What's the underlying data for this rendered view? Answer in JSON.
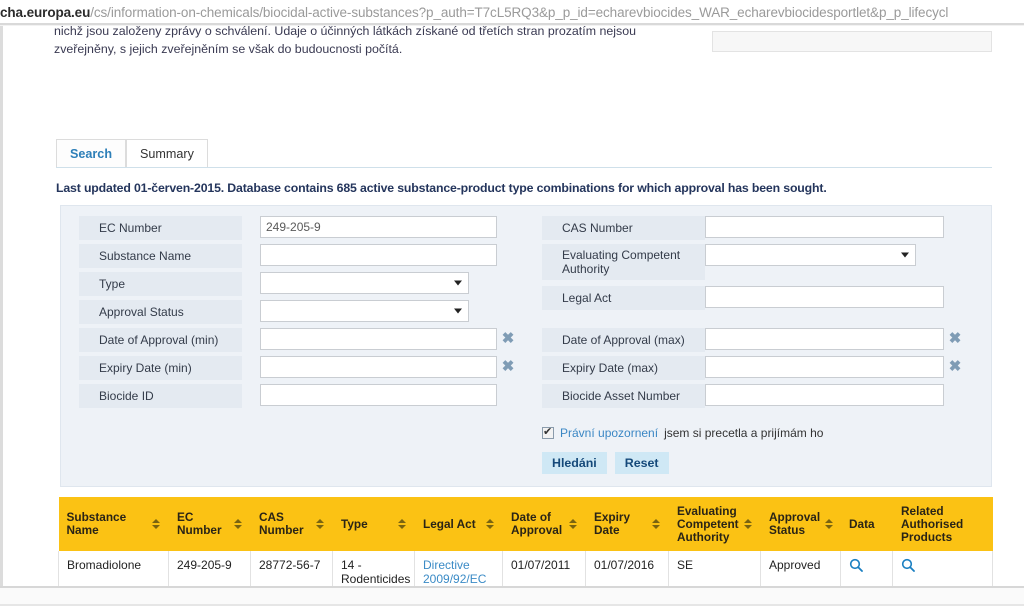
{
  "browser": {
    "url_host": "cha.europa.eu",
    "url_path": "/cs/information-on-chemicals/biocidal-active-substances?p_auth=T7cL5RQ3&p_p_id=echarevbiocides_WAR_echarevbiocidesportlet&p_p_lifecycl"
  },
  "intro": {
    "line1": "nichž jsou založeny zprávy o schválení. Údaje o účinných látkách získané od třetích stran prozatím nejsou",
    "line2": "zveřejněny, s jejich zveřejněním se však do budoucnosti počítá."
  },
  "tabs": [
    {
      "label": "Search",
      "active": true
    },
    {
      "label": "Summary",
      "active": false
    }
  ],
  "status": {
    "last_updated": "Last updated 01-červen-2015. Database contains 685 active substance-product type combinations for which approval has been sought."
  },
  "search_form": {
    "left": [
      {
        "label": "EC Number",
        "control": "text",
        "value": "249-205-9"
      },
      {
        "label": "Substance Name",
        "control": "text",
        "value": ""
      },
      {
        "label": "Type",
        "control": "select",
        "value": ""
      },
      {
        "label": "Approval Status",
        "control": "select",
        "value": ""
      },
      {
        "label": "Date of Approval (min)",
        "control": "date",
        "value": ""
      },
      {
        "label": "Expiry Date (min)",
        "control": "date",
        "value": ""
      },
      {
        "label": "Biocide ID",
        "control": "text",
        "value": ""
      }
    ],
    "right": [
      {
        "label": "CAS Number",
        "control": "text",
        "value": ""
      },
      {
        "label": "Evaluating Competent Authority",
        "control": "select",
        "value": ""
      },
      {
        "label": "Legal Act",
        "control": "text",
        "value": ""
      },
      {
        "label": "Date of Approval (max)",
        "control": "date",
        "value": ""
      },
      {
        "label": "Expiry Date (max)",
        "control": "date",
        "value": ""
      },
      {
        "label": "Biocide Asset Number",
        "control": "text",
        "value": ""
      }
    ],
    "legal": {
      "checked": true,
      "link_text": "Právní upozornení",
      "rest_text": "jsem si precetla a prijímám ho"
    },
    "buttons": {
      "search": "Hledáni",
      "reset": "Reset"
    }
  },
  "results": {
    "columns": [
      {
        "label": "Substance Name",
        "sortable": true
      },
      {
        "label": "EC Number",
        "sortable": true
      },
      {
        "label": "CAS Number",
        "sortable": true
      },
      {
        "label": "Type",
        "sortable": true
      },
      {
        "label": "Legal Act",
        "sortable": true
      },
      {
        "label": "Date of Approval",
        "sortable": true
      },
      {
        "label": "Expiry Date",
        "sortable": true
      },
      {
        "label": "Evaluating Competent Authority",
        "sortable": true
      },
      {
        "label": "Approval Status",
        "sortable": true
      },
      {
        "label": "Data",
        "sortable": false
      },
      {
        "label": "Related Authorised Products",
        "sortable": false
      }
    ],
    "rows": [
      {
        "substance_name": "Bromadiolone",
        "ec_number": "249-205-9",
        "cas_number": "28772-56-7",
        "type": "14 - Rodenticides",
        "legal_act": "Directive 2009/92/EC",
        "date_of_approval": "01/07/2011",
        "expiry_date": "01/07/2016",
        "evaluating_competent_authority": "SE",
        "approval_status": "Approved",
        "data_icon": "search-icon",
        "related_icon": "search-icon"
      }
    ]
  },
  "colors": {
    "table_header": "#fbc214",
    "accent_link": "#3b8bc6",
    "panel_bg": "#eef2f7",
    "label_bg": "#e4eaf1",
    "button_bg": "#cfe8f5"
  }
}
